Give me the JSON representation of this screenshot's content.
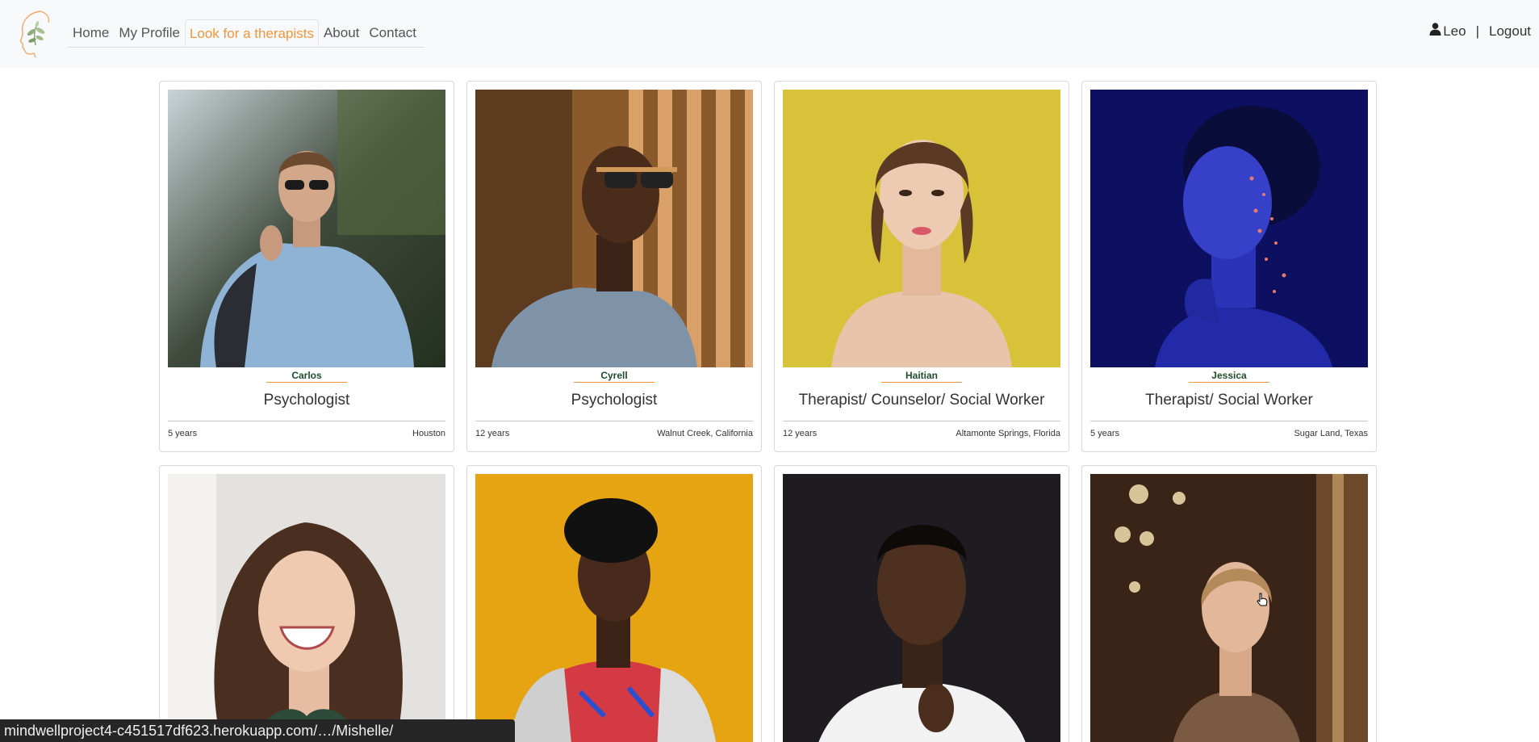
{
  "nav": {
    "links": [
      {
        "label": "Home"
      },
      {
        "label": "My Profile"
      },
      {
        "label": "Look for a therapists"
      },
      {
        "label": "About"
      },
      {
        "label": "Contact"
      }
    ],
    "user_name": "Leo",
    "separator": "|",
    "logout_label": "Logout"
  },
  "therapists": [
    {
      "name": "Carlos",
      "title": "Psychologist",
      "years": "5 years",
      "location": "Houston"
    },
    {
      "name": "Cyrell",
      "title": "Psychologist",
      "years": "12 years",
      "location": "Walnut Creek, California"
    },
    {
      "name": "Haitian",
      "title": "Therapist/ Counselor/ Social Worker",
      "years": "12 years",
      "location": "Altamonte Springs, Florida"
    },
    {
      "name": "Jessica",
      "title": "Therapist/ Social Worker",
      "years": "5 years",
      "location": "Sugar Land, Texas"
    }
  ],
  "status_bar": {
    "url": "mindwellproject4-c451517df623.herokuapp.com/…/Mishelle/"
  },
  "colors": {
    "accent": "#f0963c",
    "name_green": "#1f4d2b",
    "navbar_bg": "#f8f9fa"
  }
}
